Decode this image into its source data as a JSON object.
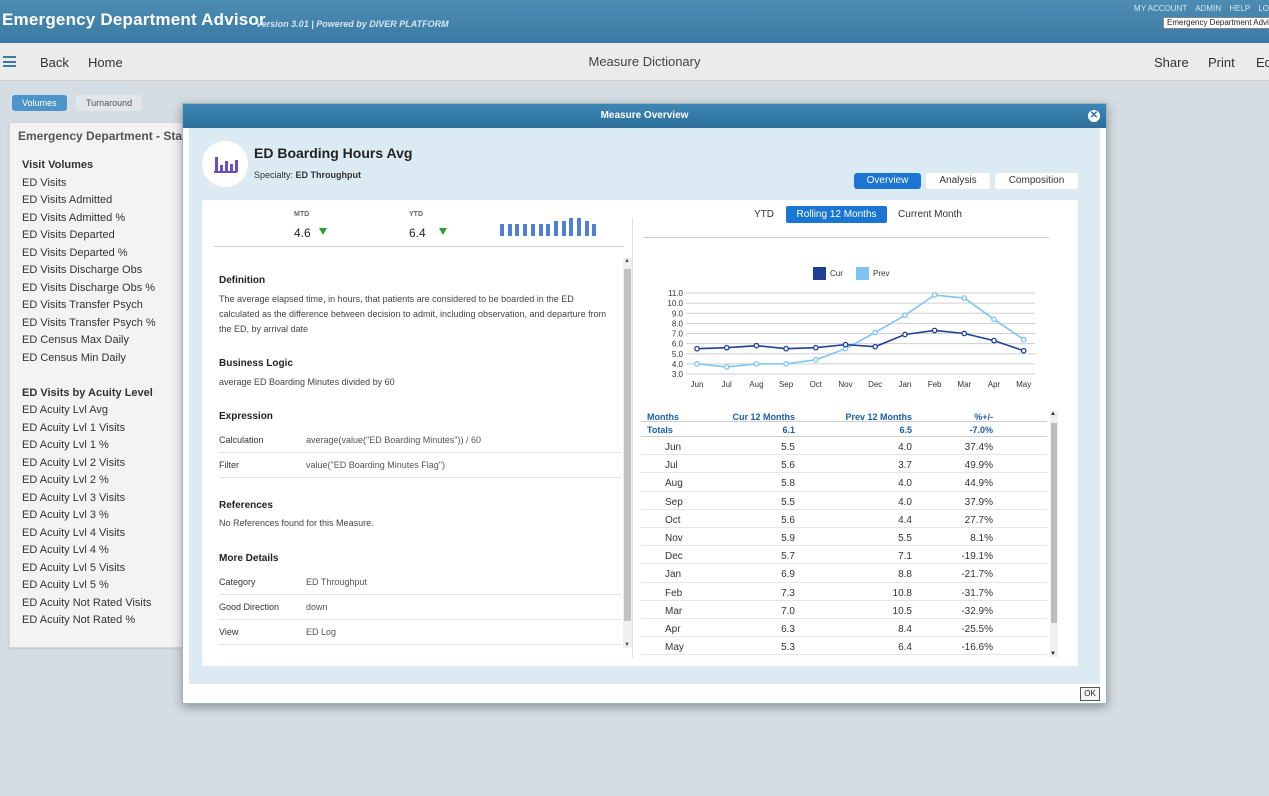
{
  "header": {
    "title": "Emergency Department Advisor",
    "version": "Version 3.01  |  Powered by DIVER PLATFORM",
    "top_links": [
      "MY ACCOUNT",
      "ADMIN",
      "HELP",
      "LO"
    ],
    "app_select": "Emergency Department Advisor"
  },
  "toolbar": {
    "back": "Back",
    "home": "Home",
    "center_title": "Measure Dictionary",
    "share": "Share",
    "print": "Print",
    "edit": "Ed"
  },
  "page_tabs": [
    "Volumes",
    "Turnaround"
  ],
  "left_panel": {
    "title": "Emergency Department - Sta",
    "group1_title": "Visit Volumes",
    "group1_items": [
      "ED Visits",
      "ED Visits Admitted",
      "ED Visits Admitted %",
      "ED Visits Departed",
      "ED Visits Departed %",
      "ED Visits Discharge Obs",
      "ED Visits Discharge Obs %",
      "ED Visits Transfer Psych",
      "ED Visits Transfer Psych %",
      "ED Census Max Daily",
      "ED Census Min Daily"
    ],
    "group2_title": "ED Visits by Acuity Level",
    "group2_items": [
      "ED Acuity Lvl Avg",
      "ED Acuity Lvl 1 Visits",
      "ED Acuity Lvl 1 %",
      "ED Acuity Lvl 2 Visits",
      "ED Acuity Lvl 2 %",
      "ED Acuity Lvl 3 Visits",
      "ED Acuity Lvl 3 %",
      "ED Acuity Lvl 4 Visits",
      "ED Acuity Lvl 4 %",
      "ED Acuity Lvl 5 Visits",
      "ED Acuity Lvl 5 %",
      "ED Acuity Not Rated Visits",
      "ED Acuity Not Rated %"
    ]
  },
  "modal": {
    "header_title": "Measure Overview",
    "close_glyph": "✕",
    "ok_label": "OK",
    "measure_title": "ED Boarding Hours Avg",
    "specialty_label": "Specialty:",
    "specialty_value": "ED Throughput",
    "tabs": [
      "Overview",
      "Analysis",
      "Composition"
    ],
    "mtd_label": "MTD",
    "mtd_value": "4.6",
    "ytd_label": "YTD",
    "ytd_value": "6.4",
    "sections": {
      "definition_title": "Definition",
      "definition_text": "The average elapsed time, in hours, that patients are considered to be boarded in the ED calculated as the difference between decision to admit, including observation, and departure from the ED, by arrival date",
      "business_logic_title": "Business Logic",
      "business_logic_text": "average ED Boarding Minutes divided by 60",
      "expression_title": "Expression",
      "calculation_label": "Calculation",
      "calculation_value": "average(value(\"ED Boarding Minutes\")) / 60",
      "filter_label": "Filter",
      "filter_value": "value(\"ED Boarding Minutes Flag\")",
      "references_title": "References",
      "references_text": "No References found for this Measure.",
      "more_details_title": "More Details",
      "category_label": "Category",
      "category_value": "ED Throughput",
      "good_direction_label": "Good Direction",
      "good_direction_value": "down",
      "view_label": "View",
      "view_value": "ED Log"
    },
    "period_tabs": [
      "YTD",
      "Rolling 12 Months",
      "Current Month"
    ],
    "table": {
      "headers": [
        "Months",
        "Cur 12 Months",
        "Prev 12 Months",
        "%+/-"
      ],
      "totals": [
        "Totals",
        "6.1",
        "6.5",
        "-7.0%"
      ],
      "rows": [
        [
          "Jun",
          "5.5",
          "4.0",
          "37.4%"
        ],
        [
          "Jul",
          "5.6",
          "3.7",
          "49.9%"
        ],
        [
          "Aug",
          "5.8",
          "4.0",
          "44.9%"
        ],
        [
          "Sep",
          "5.5",
          "4.0",
          "37.9%"
        ],
        [
          "Oct",
          "5.6",
          "4.4",
          "27.7%"
        ],
        [
          "Nov",
          "5.9",
          "5.5",
          "8.1%"
        ],
        [
          "Dec",
          "5.7",
          "7.1",
          "-19.1%"
        ],
        [
          "Jan",
          "6.9",
          "8.8",
          "-21.7%"
        ],
        [
          "Feb",
          "7.3",
          "10.8",
          "-31.7%"
        ],
        [
          "Mar",
          "7.0",
          "10.5",
          "-32.9%"
        ],
        [
          "Apr",
          "6.3",
          "8.4",
          "-25.5%"
        ],
        [
          "May",
          "5.3",
          "6.4",
          "-16.6%"
        ]
      ]
    }
  },
  "colors": {
    "cur": "#1f3f94",
    "prev": "#7fc4f5",
    "accent": "#1a76d2",
    "header": "#3b7aa3",
    "down_arrow": "#2aa52a"
  },
  "chart_data": {
    "type": "line",
    "categories": [
      "Jun",
      "Jul",
      "Aug",
      "Sep",
      "Oct",
      "Nov",
      "Dec",
      "Jan",
      "Feb",
      "Mar",
      "Apr",
      "May"
    ],
    "series": [
      {
        "name": "Cur",
        "values": [
          5.5,
          5.6,
          5.8,
          5.5,
          5.6,
          5.9,
          5.7,
          6.9,
          7.3,
          7.0,
          6.3,
          5.3
        ]
      },
      {
        "name": "Prev",
        "values": [
          4.0,
          3.7,
          4.0,
          4.0,
          4.4,
          5.5,
          7.1,
          8.8,
          10.8,
          10.5,
          8.4,
          6.4
        ]
      }
    ],
    "yticks": [
      "11.0",
      "10.0",
      "9.0",
      "8.0",
      "7.0",
      "6.0",
      "5.0",
      "4.0",
      "3.0"
    ],
    "ylim": [
      3,
      11
    ],
    "legend": "top-center",
    "grid": true
  },
  "spark_data": [
    0.6,
    0.6,
    0.6,
    0.6,
    0.6,
    0.6,
    0.6,
    0.75,
    0.75,
    0.9,
    0.9,
    0.75,
    0.6
  ],
  "icons": {
    "hamburger": "menu-icon",
    "measure": "bar-chart-icon"
  }
}
